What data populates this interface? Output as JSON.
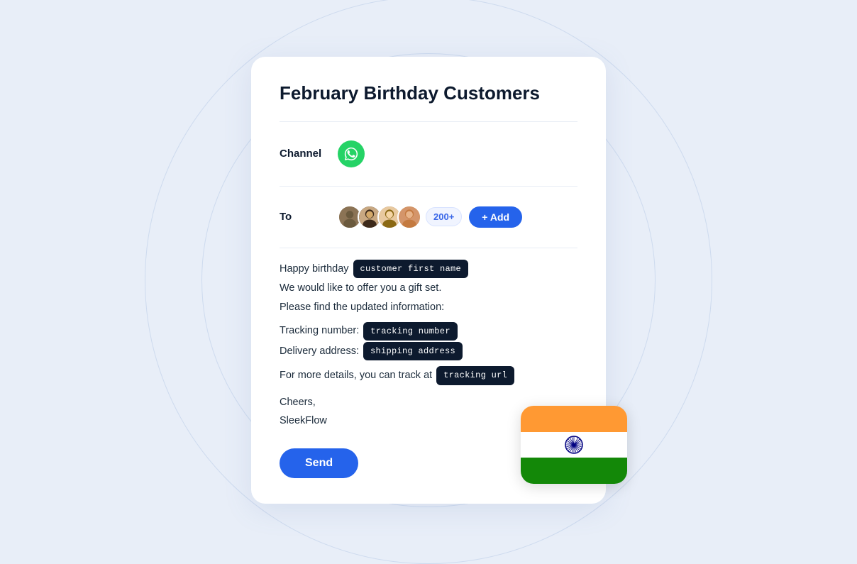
{
  "background": {
    "color": "#e8eef8"
  },
  "card": {
    "title": "February Birthday Customers",
    "channel_label": "Channel",
    "to_label": "To",
    "recipient_count": "200+",
    "add_button_label": "+ Add",
    "message": {
      "greeting_prefix": "Happy birthday",
      "customer_first_name_tag": "customer first name",
      "line1": "We would like to offer you a gift set.",
      "line2": "Please find the updated information:",
      "tracking_prefix": "Tracking number:",
      "tracking_tag": "tracking number",
      "delivery_prefix": "Delivery address:",
      "shipping_tag": "shipping address",
      "more_details": "For more details, you can track at",
      "tracking_url_tag": "tracking url",
      "sign_off": "Cheers,",
      "brand": "SleekFlow"
    },
    "send_button_label": "Send"
  },
  "flag": {
    "country": "India",
    "emoji": "🔵"
  }
}
